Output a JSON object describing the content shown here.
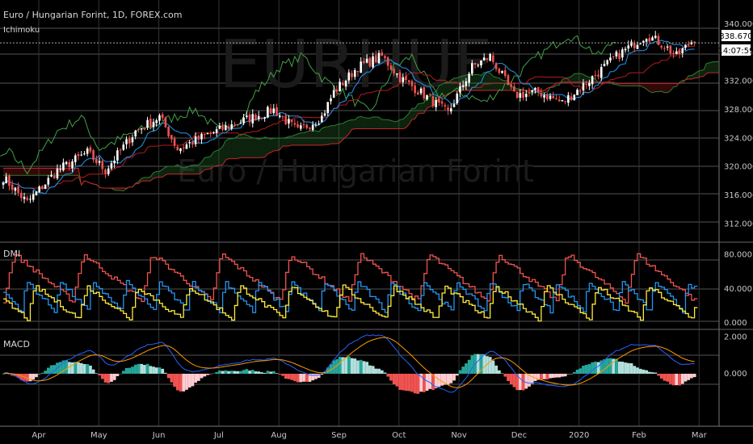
{
  "header": {
    "title": "Euro / Hungarian Forint, 1D, FOREX.com",
    "indicator": "Ichimoku"
  },
  "watermark": {
    "symbol": "EURHUF",
    "name": "Euro / Hungarian Forint"
  },
  "price_tags": {
    "last": "338.670",
    "countdown": "14:07:59"
  },
  "panes": {
    "dmi_label": "DMI",
    "macd_label": "MACD"
  },
  "colors": {
    "up_candle": "#ffffff",
    "down_candle": "#ef5350",
    "tenkan": "#2196f3",
    "kijun": "#b71c1c",
    "span_a": "#2e7d32",
    "span_b": "#c62828",
    "lagging": "#43a047",
    "di_plus": "#ef5350",
    "di_minus": "#2196f3",
    "adx": "#ffeb3b",
    "macd": "#2962ff",
    "signal": "#ff9800",
    "hist_up": "#26a69a",
    "hist_up_light": "#b2dfdb",
    "hist_down": "#ef5350",
    "hist_down_light": "#ffcdd2"
  },
  "chart_data": [
    {
      "type": "candlestick",
      "name": "Price",
      "y_ticks": [
        "340.000",
        "336.000",
        "332.000",
        "328.000",
        "324.000",
        "320.000",
        "316.000",
        "312.000"
      ],
      "ylim": [
        310,
        340
      ],
      "x_ticks": [
        "Apr",
        "May",
        "Jun",
        "Jul",
        "Aug",
        "Sep",
        "Oct",
        "Nov",
        "Dec",
        "2020",
        "Feb",
        "Mar"
      ],
      "anchors": [
        [
          0,
          318.5
        ],
        [
          8,
          315.0
        ],
        [
          18,
          319.5
        ],
        [
          28,
          322.0
        ],
        [
          34,
          319.5
        ],
        [
          44,
          325.0
        ],
        [
          52,
          327.0
        ],
        [
          58,
          322.5
        ],
        [
          68,
          324.5
        ],
        [
          80,
          326.5
        ],
        [
          90,
          328.0
        ],
        [
          98,
          325.0
        ],
        [
          106,
          327.0
        ],
        [
          110,
          330.5
        ],
        [
          118,
          334.0
        ],
        [
          126,
          335.5
        ],
        [
          132,
          332.5
        ],
        [
          142,
          329.5
        ],
        [
          148,
          327.5
        ],
        [
          156,
          334.0
        ],
        [
          162,
          335.5
        ],
        [
          170,
          330.0
        ],
        [
          178,
          330.5
        ],
        [
          186,
          329.0
        ],
        [
          196,
          332.5
        ],
        [
          204,
          335.5
        ],
        [
          214,
          338.5
        ],
        [
          220,
          337.0
        ],
        [
          224,
          335.5
        ],
        [
          230,
          338.0
        ]
      ]
    },
    {
      "type": "line",
      "name": "DMI",
      "series": [
        "+DI",
        "-DI",
        "ADX"
      ],
      "y_ticks": [
        "80.000",
        "40.000",
        "0.000"
      ],
      "ylim": [
        0,
        90
      ]
    },
    {
      "type": "line",
      "name": "MACD",
      "series": [
        "MACD",
        "Signal",
        "Histogram"
      ],
      "y_ticks": [
        "2.000",
        "0.000"
      ],
      "ylim": [
        -2.6,
        2.2
      ]
    }
  ]
}
